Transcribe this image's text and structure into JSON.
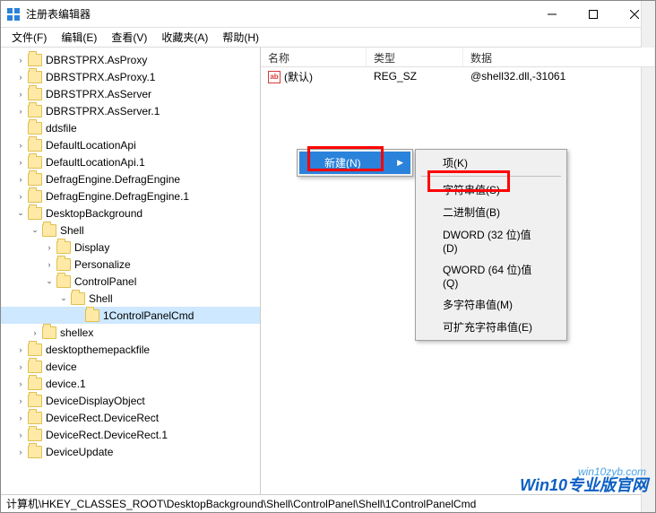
{
  "window": {
    "title": "注册表编辑器"
  },
  "menubar": {
    "file": "文件(F)",
    "edit": "编辑(E)",
    "view": "查看(V)",
    "favorites": "收藏夹(A)",
    "help": "帮助(H)"
  },
  "tree": [
    {
      "indent": 1,
      "toggle": ">",
      "label": "DBRSTPRX.AsProxy"
    },
    {
      "indent": 1,
      "toggle": ">",
      "label": "DBRSTPRX.AsProxy.1"
    },
    {
      "indent": 1,
      "toggle": ">",
      "label": "DBRSTPRX.AsServer"
    },
    {
      "indent": 1,
      "toggle": ">",
      "label": "DBRSTPRX.AsServer.1"
    },
    {
      "indent": 1,
      "toggle": "",
      "label": "ddsfile"
    },
    {
      "indent": 1,
      "toggle": ">",
      "label": "DefaultLocationApi"
    },
    {
      "indent": 1,
      "toggle": ">",
      "label": "DefaultLocationApi.1"
    },
    {
      "indent": 1,
      "toggle": ">",
      "label": "DefragEngine.DefragEngine"
    },
    {
      "indent": 1,
      "toggle": ">",
      "label": "DefragEngine.DefragEngine.1"
    },
    {
      "indent": 1,
      "toggle": "v",
      "label": "DesktopBackground"
    },
    {
      "indent": 2,
      "toggle": "v",
      "label": "Shell"
    },
    {
      "indent": 3,
      "toggle": ">",
      "label": "Display"
    },
    {
      "indent": 3,
      "toggle": ">",
      "label": "Personalize"
    },
    {
      "indent": 3,
      "toggle": "v",
      "label": "ControlPanel"
    },
    {
      "indent": 4,
      "toggle": "v",
      "label": "Shell"
    },
    {
      "indent": 5,
      "toggle": "",
      "label": "1ControlPanelCmd",
      "selected": true
    },
    {
      "indent": 2,
      "toggle": ">",
      "label": "shellex"
    },
    {
      "indent": 1,
      "toggle": ">",
      "label": "desktopthemepackfile"
    },
    {
      "indent": 1,
      "toggle": ">",
      "label": "device"
    },
    {
      "indent": 1,
      "toggle": ">",
      "label": "device.1"
    },
    {
      "indent": 1,
      "toggle": ">",
      "label": "DeviceDisplayObject"
    },
    {
      "indent": 1,
      "toggle": ">",
      "label": "DeviceRect.DeviceRect"
    },
    {
      "indent": 1,
      "toggle": ">",
      "label": "DeviceRect.DeviceRect.1"
    },
    {
      "indent": 1,
      "toggle": ">",
      "label": "DeviceUpdate"
    }
  ],
  "list": {
    "headers": {
      "name": "名称",
      "type": "类型",
      "data": "数据"
    },
    "rows": [
      {
        "name": "(默认)",
        "type": "REG_SZ",
        "data": "@shell32.dll,-31061",
        "icon": "ab"
      }
    ]
  },
  "context_menu_primary": {
    "new": "新建(N)"
  },
  "context_menu_sub": [
    "项(K)",
    "字符串值(S)",
    "二进制值(B)",
    "DWORD (32 位)值(D)",
    "QWORD (64 位)值(Q)",
    "多字符串值(M)",
    "可扩充字符串值(E)"
  ],
  "statusbar": {
    "path": "计算机\\HKEY_CLASSES_ROOT\\DesktopBackground\\Shell\\ControlPanel\\Shell\\1ControlPanelCmd"
  },
  "watermark": {
    "url": "win10zyb.com",
    "text": "Win10专业版官网"
  }
}
